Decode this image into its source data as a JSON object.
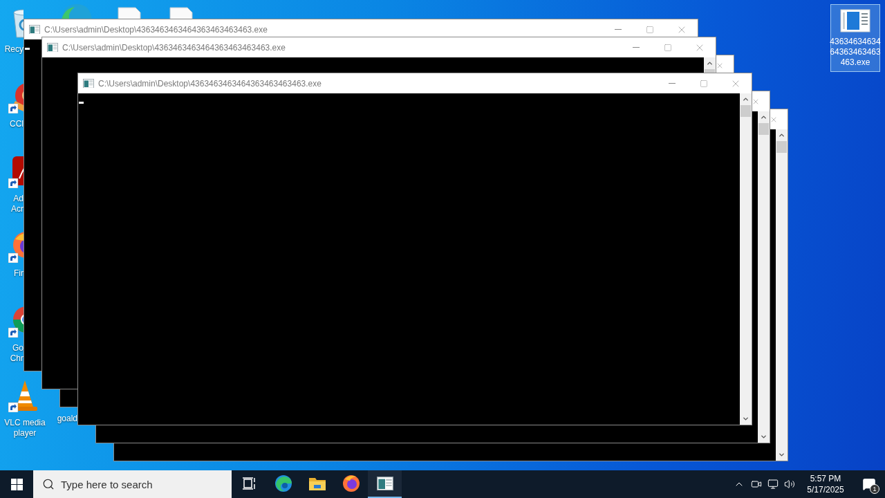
{
  "desktop_icons": [
    {
      "kind": "recycle-bin",
      "lines": [
        "Recy"
      ]
    },
    {
      "kind": "ccleaner",
      "lines": [
        "CCl"
      ]
    },
    {
      "kind": "acrobat",
      "lines": [
        "Ad",
        "Acr"
      ]
    },
    {
      "kind": "firefox",
      "lines": [
        "Fir"
      ]
    },
    {
      "kind": "chrome",
      "lines": [
        "Go",
        "Chr"
      ]
    },
    {
      "kind": "vlc",
      "lines": [
        "VLC media",
        "player"
      ]
    }
  ],
  "second_column_icons": [
    {
      "lines": [
        "goald"
      ]
    }
  ],
  "selected_icon": {
    "lines": [
      "43634634634",
      "64363463463",
      "463.exe"
    ],
    "selected": true
  },
  "windows": [
    {
      "kind": "titled",
      "title": "C:\\Users\\admin\\Desktop\\4363463463464363463463463.exe",
      "cursor": true
    },
    {
      "kind": "titled",
      "title": "C:\\Users\\admin\\Desktop\\4363463463464363463463463.exe",
      "cursor": false
    },
    {
      "kind": "covered"
    },
    {
      "kind": "titled",
      "title": "C:\\Users\\admin\\Desktop\\4363463463464363463463463.exe",
      "cursor": true
    },
    {
      "kind": "covered"
    },
    {
      "kind": "covered"
    }
  ],
  "taskbar": {
    "search": {
      "placeholder": "Type here to search"
    },
    "apps": [
      {
        "kind": "task-view",
        "active": false
      },
      {
        "kind": "edge",
        "active": false
      },
      {
        "kind": "explorer",
        "active": false
      },
      {
        "kind": "firefox",
        "active": false
      },
      {
        "kind": "console",
        "active": true
      }
    ],
    "clock": {
      "time": "5:57 PM",
      "date": "5/17/2025"
    },
    "notifications": {
      "count": "1"
    }
  }
}
